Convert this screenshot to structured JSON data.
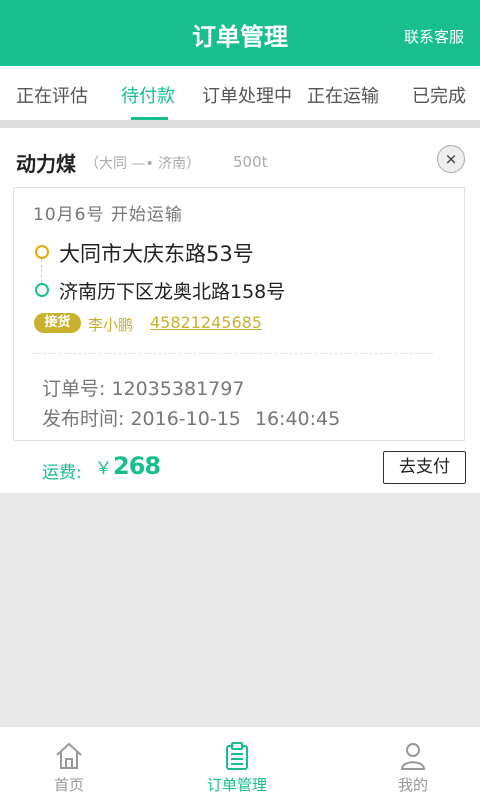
{
  "header": {
    "title": "订单管理",
    "contact": "联系客服"
  },
  "tabs": [
    {
      "label": "正在评估"
    },
    {
      "label": "待付款"
    },
    {
      "label": "订单处理中"
    },
    {
      "label": "正在运输"
    },
    {
      "label": "已完成"
    }
  ],
  "order": {
    "goods": "动力煤",
    "route_from": "（大同",
    "route_arrow": "—•",
    "route_to": "济南）",
    "weight": "500t",
    "close_icon": "×",
    "start": "10月6号 开始运输",
    "address_from": "大同市大庆东路53号",
    "address_to": "济南历下区龙奥北路158号",
    "badge": "接货",
    "contact_name": "李小鹏",
    "contact_phone": "45821245685",
    "order_no_label": "订单号:",
    "order_no": "12035381797",
    "publish_label": "发布时间:",
    "publish_date": "2016-10-15",
    "publish_time": "16:40:45",
    "fee_label": "运费:",
    "fee_currency": "￥",
    "fee_value": "268",
    "pay_button": "去支付"
  },
  "bottom_nav": [
    {
      "label": "首页",
      "icon": "home-icon"
    },
    {
      "label": "订单管理",
      "icon": "clipboard-icon"
    },
    {
      "label": "我的",
      "icon": "user-icon"
    }
  ],
  "colors": {
    "brand": "#19be8f",
    "accent": "#c9b12d",
    "start_dot": "#f0a500"
  }
}
